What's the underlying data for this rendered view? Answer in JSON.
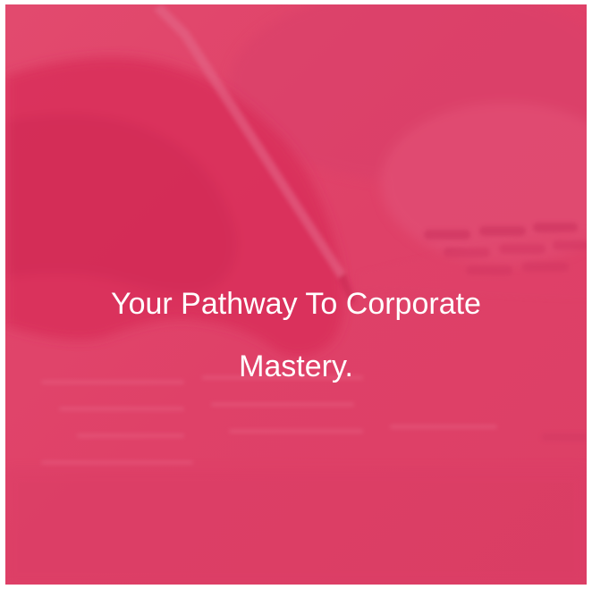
{
  "hero": {
    "title_line1": "Your Pathway To Corporate",
    "title_line2": "Mastery.",
    "overlay_color": "#e0436a",
    "text_color": "#ffffff",
    "background_image": "hand-with-pen-over-document-photo"
  }
}
